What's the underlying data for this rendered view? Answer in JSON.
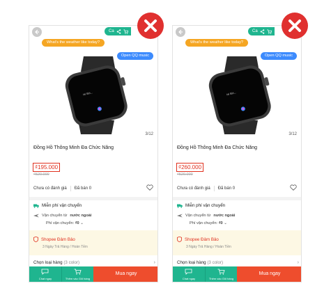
{
  "colors": {
    "brand_green": "#1fb58f",
    "buy_red": "#ee4d2d",
    "price_red": "#e0301e",
    "close_red": "#e0302f",
    "bubble_orange": "#f5a623",
    "bubble_blue": "#3d8bfd"
  },
  "screens": [
    {
      "top_pill": "Ca",
      "voice_bubble": "What's the weather like today?",
      "app_bubble": "Open QQ music",
      "image_counter": "3/12",
      "title": "Đồng Hồ Thông Minh Đa Chức Năng",
      "price": "₫195.000",
      "old_price": "₫520.000",
      "rating": "Chưa có đánh giá",
      "sold": "Đã bán 0",
      "free_shipping": "Miễn phí vận chuyển",
      "shipping_from_prefix": "Vận chuyển từ",
      "shipping_from": "nước ngoài",
      "shipping_fee_label": "Phí vận chuyển:",
      "shipping_fee": "₫0",
      "guarantee_title": "Shopee Đảm Bảo",
      "guarantee_sub": "3 Ngày Trả Hàng / Hoàn Tiền",
      "variant_label": "Chọn loại hàng",
      "variant_count": "(3 color)",
      "chat_label": "Chat ngay",
      "cart_label": "Thêm vào Giỏ hàng",
      "buy_label": "Mua ngay"
    },
    {
      "top_pill": "Ca",
      "voice_bubble": "What's the weather like today?",
      "app_bubble": "Open QQ music",
      "image_counter": "3/12",
      "title": "Đồng Hồ Thông Minh Đa Chức Năng",
      "price": "₫260.000",
      "old_price": "₫520.000",
      "rating": "Chưa có đánh giá",
      "sold": "Đã bán 0",
      "free_shipping": "Miễn phí vận chuyển",
      "shipping_from_prefix": "Vận chuyển từ",
      "shipping_from": "nước ngoài",
      "shipping_fee_label": "Phí vận chuyển:",
      "shipping_fee": "₫0",
      "guarantee_title": "Shopee Đảm Bảo",
      "guarantee_sub": "3 Ngày Trả Hàng / Hoàn Tiền",
      "variant_label": "Chọn loại hàng",
      "variant_count": "(3 color)",
      "chat_label": "Chat ngay",
      "cart_label": "Thêm vào Giỏ hàng",
      "buy_label": "Mua ngay"
    }
  ]
}
